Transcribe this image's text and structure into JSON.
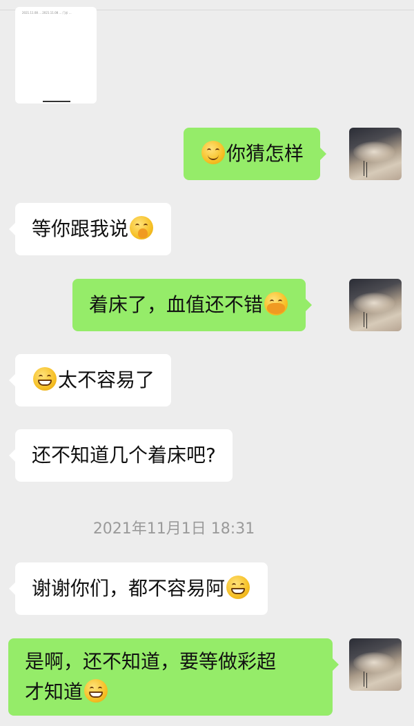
{
  "document_preview": {
    "text": "2021.11.08 ... 2021.11.08 ... 门诊 ..."
  },
  "messages": [
    {
      "side": "right",
      "text": "你猜怎样",
      "emoji": "smiling-face-icon",
      "emoji_position": "before"
    },
    {
      "side": "left",
      "text": "等你跟我说",
      "emoji": "thinking-face-icon",
      "emoji_position": "after"
    },
    {
      "side": "right",
      "text": "着床了，血值还不错",
      "emoji": "fist-bump-icon",
      "emoji_position": "after"
    },
    {
      "side": "left",
      "text": "太不容易了",
      "emoji": "grinning-face-icon",
      "emoji_position": "before"
    },
    {
      "side": "left",
      "text": "还不知道几个着床吧?"
    },
    {
      "side": "left",
      "text": "谢谢你们，都不容易阿",
      "emoji": "grinning-face-icon",
      "emoji_position": "after"
    },
    {
      "side": "right",
      "text_line1": "是啊，还不知道，要等做彩超",
      "text_line2": "才知道",
      "emoji": "grinning-face-icon",
      "emoji_position": "after"
    }
  ],
  "timestamp": "2021年11月1日 18:31",
  "colors": {
    "background": "#ededed",
    "incoming_bubble": "#ffffff",
    "outgoing_bubble": "#95ec69",
    "timestamp_text": "#9a9a9a"
  }
}
